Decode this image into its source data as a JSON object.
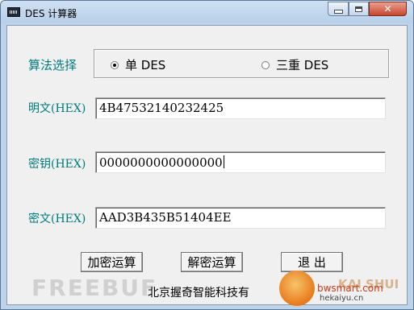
{
  "window": {
    "title": "DES 计算器",
    "minimize_label": "—",
    "close_label": "✕"
  },
  "algorithm": {
    "label": "算法选择",
    "options": [
      {
        "label": "单 DES",
        "selected": true
      },
      {
        "label": "三重 DES",
        "selected": false
      }
    ]
  },
  "fields": {
    "plaintext": {
      "label": "明文(HEX)",
      "value": "4B47532140232425"
    },
    "key": {
      "label": "密钥(HEX)",
      "value": "0000000000000000"
    },
    "ciphertext": {
      "label": "密文(HEX)",
      "value": "AAD3B435B51404EE"
    }
  },
  "buttons": {
    "encrypt": "加密运算",
    "decrypt": "解密运算",
    "exit": "退 出"
  },
  "company": "北京握奇智能科技有",
  "watermarks": {
    "left": "FREEBUF",
    "url1": "bwsmart.com",
    "url2": "hekaiyu.cn",
    "brand": "KAI SHUI"
  },
  "colors": {
    "label_color": "#007c7c",
    "frame_color": "#bcd3ea",
    "client_bg": "#f0f0f0"
  }
}
